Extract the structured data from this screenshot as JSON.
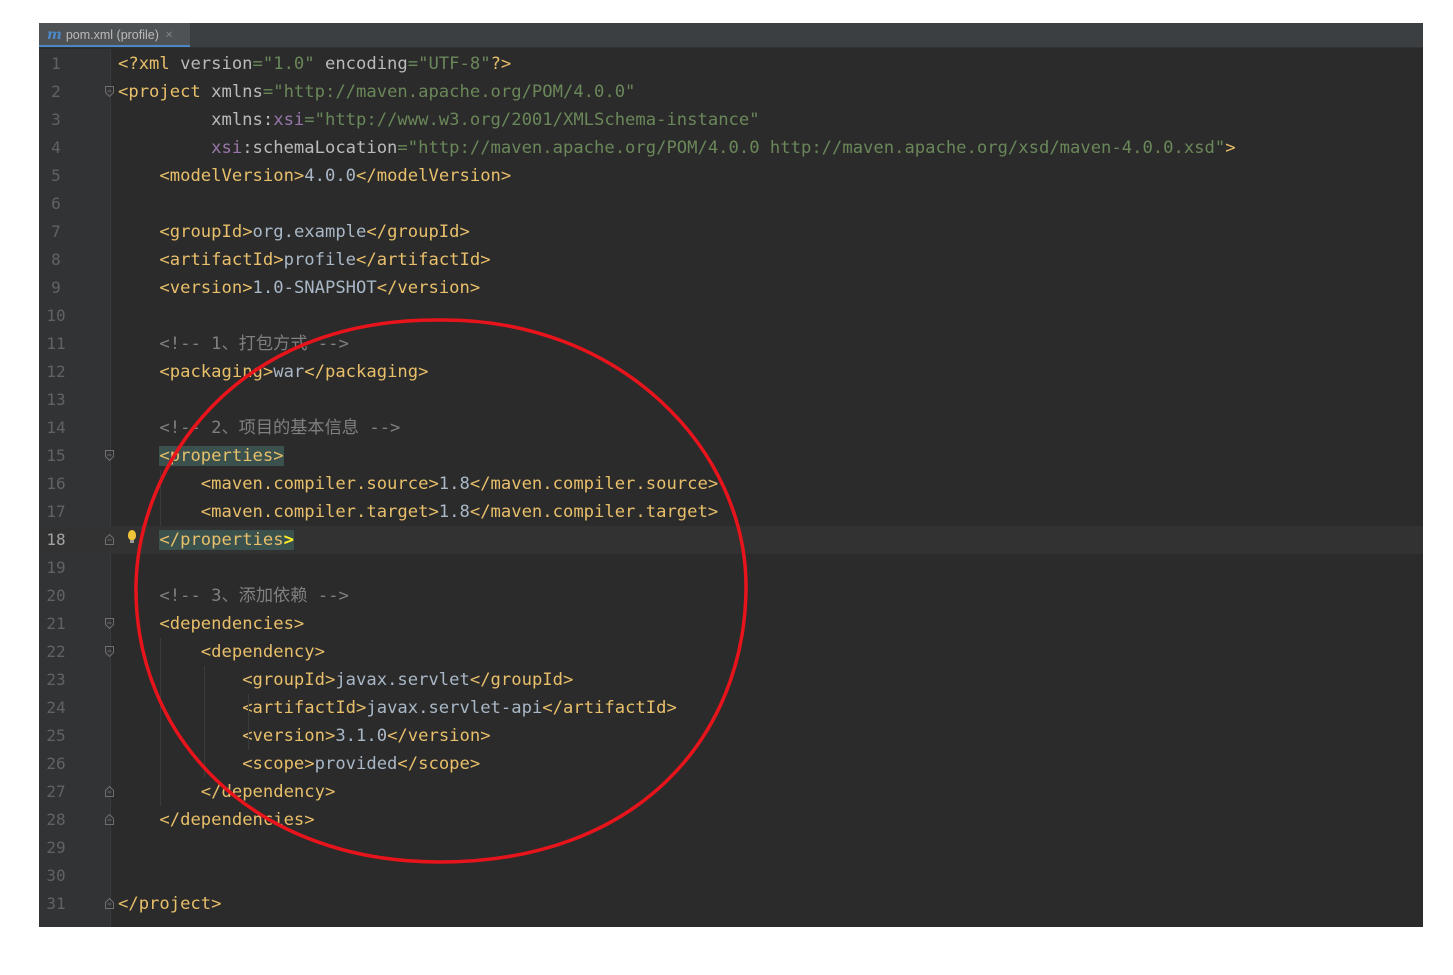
{
  "tab": {
    "icon": "maven-icon",
    "icon_glyph": "m",
    "label": "pom.xml (profile)",
    "close_glyph": "✕"
  },
  "editor": {
    "current_line": 18,
    "lines": [
      {
        "n": 1,
        "tokens": [
          [
            "decl",
            "<?xml "
          ],
          [
            "attr",
            "version"
          ],
          [
            "str",
            "=\"1.0\""
          ],
          [
            "attr",
            " encoding"
          ],
          [
            "str",
            "=\"UTF-8\""
          ],
          [
            "decl",
            "?>"
          ]
        ]
      },
      {
        "n": 2,
        "fold": "open",
        "tokens": [
          [
            "tag",
            "<project "
          ],
          [
            "attr",
            "xmlns"
          ],
          [
            "str",
            "=\"http://maven.apache.org/POM/4.0.0\""
          ]
        ]
      },
      {
        "n": 3,
        "tokens": [
          [
            "attr",
            "         xmlns"
          ],
          [
            "attr",
            ":"
          ],
          [
            "ns",
            "xsi"
          ],
          [
            "str",
            "=\"http://www.w3.org/2001/XMLSchema-instance\""
          ]
        ]
      },
      {
        "n": 4,
        "tokens": [
          [
            "ns",
            "         xsi"
          ],
          [
            "attr",
            ":schemaLocation"
          ],
          [
            "str",
            "=\"http://maven.apache.org/POM/4.0.0 http://maven.apache.org/xsd/maven-4.0.0.xsd\""
          ],
          [
            "tag",
            ">"
          ]
        ]
      },
      {
        "n": 5,
        "tokens": [
          [
            "text",
            "    "
          ],
          [
            "tag",
            "<modelVersion>"
          ],
          [
            "text",
            "4.0.0"
          ],
          [
            "tag",
            "</modelVersion>"
          ]
        ]
      },
      {
        "n": 6,
        "tokens": []
      },
      {
        "n": 7,
        "tokens": [
          [
            "text",
            "    "
          ],
          [
            "tag",
            "<groupId>"
          ],
          [
            "text",
            "org.example"
          ],
          [
            "tag",
            "</groupId>"
          ]
        ]
      },
      {
        "n": 8,
        "tokens": [
          [
            "text",
            "    "
          ],
          [
            "tag",
            "<artifactId>"
          ],
          [
            "text",
            "profile"
          ],
          [
            "tag",
            "</artifactId>"
          ]
        ]
      },
      {
        "n": 9,
        "tokens": [
          [
            "text",
            "    "
          ],
          [
            "tag",
            "<version>"
          ],
          [
            "text",
            "1.0-SNAPSHOT"
          ],
          [
            "tag",
            "</version>"
          ]
        ]
      },
      {
        "n": 10,
        "tokens": []
      },
      {
        "n": 11,
        "tokens": [
          [
            "text",
            "    "
          ],
          [
            "cmt",
            "<!-- 1、打包方式 -->"
          ]
        ]
      },
      {
        "n": 12,
        "tokens": [
          [
            "text",
            "    "
          ],
          [
            "tag",
            "<packaging>"
          ],
          [
            "text",
            "war"
          ],
          [
            "tag",
            "</packaging>"
          ]
        ]
      },
      {
        "n": 13,
        "tokens": []
      },
      {
        "n": 14,
        "tokens": [
          [
            "text",
            "    "
          ],
          [
            "cmt",
            "<!-- 2、项目的基本信息 -->"
          ]
        ]
      },
      {
        "n": 15,
        "fold": "open",
        "tokens": [
          [
            "text",
            "    "
          ],
          [
            "hl",
            "<properties>"
          ]
        ]
      },
      {
        "n": 16,
        "tokens": [
          [
            "text",
            "        "
          ],
          [
            "tag",
            "<maven.compiler.source>"
          ],
          [
            "text",
            "1.8"
          ],
          [
            "tag",
            "</maven.compiler.source>"
          ]
        ]
      },
      {
        "n": 17,
        "tokens": [
          [
            "text",
            "        "
          ],
          [
            "tag",
            "<maven.compiler.target>"
          ],
          [
            "text",
            "1.8"
          ],
          [
            "tag",
            "</maven.compiler.target>"
          ]
        ]
      },
      {
        "n": 18,
        "fold": "close",
        "bulb": true,
        "tokens": [
          [
            "text",
            "    "
          ],
          [
            "hl",
            "</properties"
          ],
          [
            "hlb",
            ">"
          ]
        ]
      },
      {
        "n": 19,
        "tokens": []
      },
      {
        "n": 20,
        "tokens": [
          [
            "text",
            "    "
          ],
          [
            "cmt",
            "<!-- 3、添加依赖 -->"
          ]
        ]
      },
      {
        "n": 21,
        "fold": "open",
        "tokens": [
          [
            "text",
            "    "
          ],
          [
            "tag",
            "<dependencies>"
          ]
        ]
      },
      {
        "n": 22,
        "fold": "open",
        "tokens": [
          [
            "text",
            "        "
          ],
          [
            "tag",
            "<dependency>"
          ]
        ]
      },
      {
        "n": 23,
        "tokens": [
          [
            "text",
            "            "
          ],
          [
            "tag",
            "<groupId>"
          ],
          [
            "text",
            "javax.servlet"
          ],
          [
            "tag",
            "</groupId>"
          ]
        ]
      },
      {
        "n": 24,
        "tokens": [
          [
            "text",
            "            "
          ],
          [
            "tag",
            "<artifactId>"
          ],
          [
            "text",
            "javax.servlet-api"
          ],
          [
            "tag",
            "</artifactId>"
          ]
        ]
      },
      {
        "n": 25,
        "tokens": [
          [
            "text",
            "            "
          ],
          [
            "tag",
            "<version>"
          ],
          [
            "text",
            "3.1.0"
          ],
          [
            "tag",
            "</version>"
          ]
        ]
      },
      {
        "n": 26,
        "tokens": [
          [
            "text",
            "            "
          ],
          [
            "tag",
            "<scope>"
          ],
          [
            "text",
            "provided"
          ],
          [
            "tag",
            "</scope>"
          ]
        ]
      },
      {
        "n": 27,
        "fold": "close",
        "tokens": [
          [
            "text",
            "        "
          ],
          [
            "tag",
            "</dependency>"
          ]
        ]
      },
      {
        "n": 28,
        "fold": "close",
        "tokens": [
          [
            "text",
            "    "
          ],
          [
            "tag",
            "</dependencies>"
          ]
        ]
      },
      {
        "n": 29,
        "tokens": []
      },
      {
        "n": 30,
        "tokens": []
      },
      {
        "n": 31,
        "fold": "close",
        "tokens": [
          [
            "tag",
            "</project>"
          ]
        ]
      }
    ]
  },
  "colors": {
    "editor_bg": "#2b2b2b",
    "tag": "#e8bf6a",
    "string": "#6a8759",
    "comment": "#808080",
    "namespace": "#9876aa",
    "annotation_circle": "#e8141c"
  },
  "annotation": {
    "shape": "ellipse",
    "color": "#e8141c"
  }
}
